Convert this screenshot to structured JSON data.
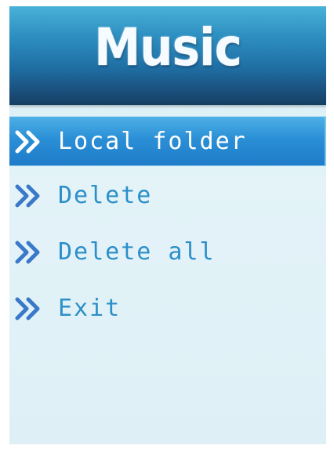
{
  "header": {
    "title": "Music"
  },
  "menu": {
    "items": [
      {
        "label": "Local folder",
        "selected": true
      },
      {
        "label": "Delete",
        "selected": false
      },
      {
        "label": "Delete all",
        "selected": false
      },
      {
        "label": "Exit",
        "selected": false
      }
    ]
  },
  "icons": {
    "item_marker": "double-chevron-right-icon"
  },
  "colors": {
    "header_top": "#49b2d7",
    "header_bottom": "#163f63",
    "background": "#dff1f7",
    "selected_bg": "#2a8fd6",
    "item_text": "#2c8fc9",
    "selected_text": "#ffffff",
    "chevron": "#3a78c9"
  }
}
